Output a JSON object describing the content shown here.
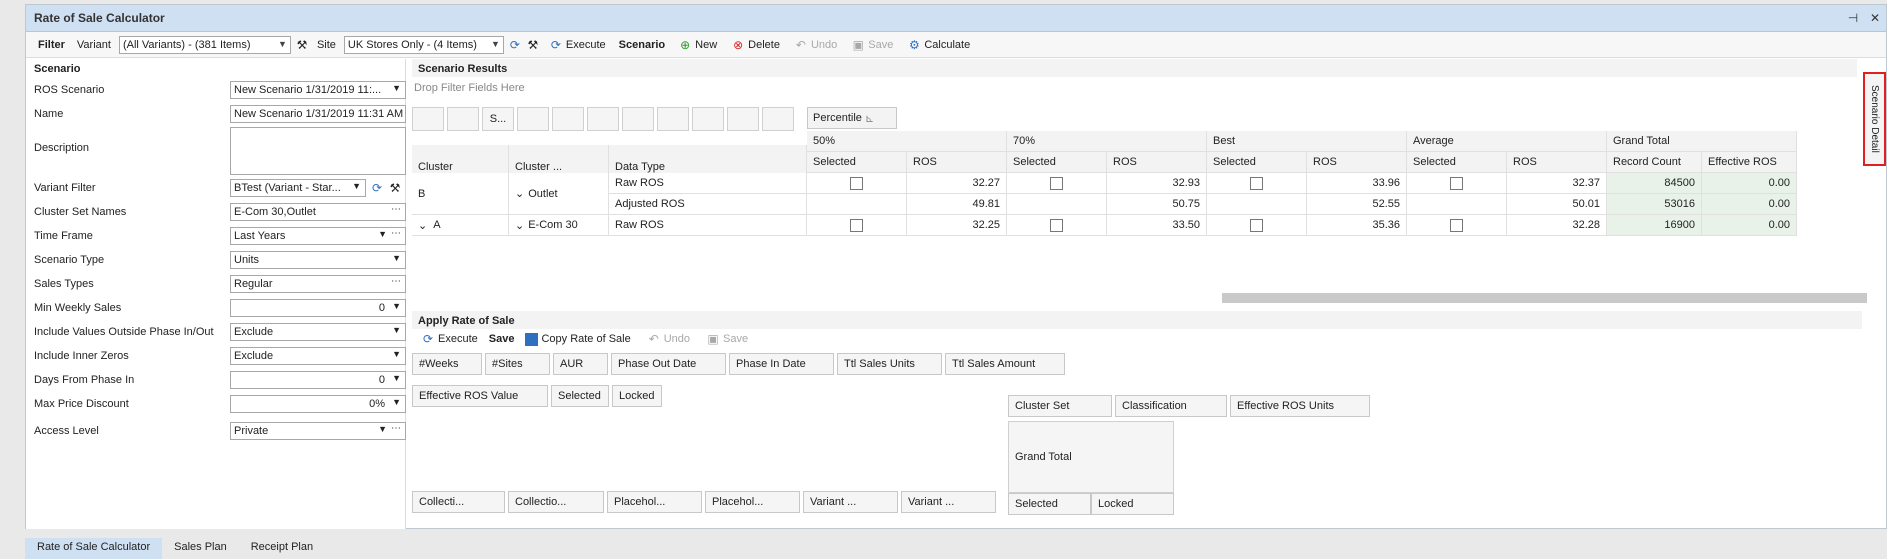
{
  "window": {
    "title": "Rate of Sale Calculator"
  },
  "toolbar": {
    "filter": "Filter",
    "variant_label": "Variant",
    "variant_value": "(All Variants) - (381 Items)",
    "site_label": "Site",
    "site_value": "UK Stores Only - (4 Items)",
    "execute": "Execute",
    "scenario": "Scenario",
    "new": "New",
    "delete": "Delete",
    "undo": "Undo",
    "save": "Save",
    "calculate": "Calculate"
  },
  "scenario_panel": {
    "title": "Scenario",
    "fields": [
      {
        "label": "ROS Scenario",
        "value": "New Scenario 1/31/2019 11:..."
      },
      {
        "label": "Name",
        "value": "New Scenario 1/31/2019 11:31 AM"
      },
      {
        "label": "Description",
        "value": ""
      },
      {
        "label": "Variant Filter",
        "value": "BTest (Variant - Star..."
      },
      {
        "label": "Cluster Set Names",
        "value": "E-Com 30,Outlet"
      },
      {
        "label": "Time Frame",
        "value": "Last Years"
      },
      {
        "label": "Scenario Type",
        "value": "Units"
      },
      {
        "label": "Sales Types",
        "value": "Regular"
      },
      {
        "label": "Min Weekly Sales",
        "value": "0"
      },
      {
        "label": "Include Values Outside Phase In/Out",
        "value": "Exclude"
      },
      {
        "label": "Include Inner Zeros",
        "value": "Exclude"
      },
      {
        "label": "Days From Phase In",
        "value": "0"
      },
      {
        "label": "Max Price Discount",
        "value": "0%"
      },
      {
        "label": "Access Level",
        "value": "Private"
      }
    ]
  },
  "results": {
    "title": "Scenario Results",
    "drop_hint": "Drop Filter Fields Here",
    "filter_box_label": "S...",
    "percentile": "Percentile",
    "row_headers": [
      "Cluster",
      "Cluster ...",
      "Data Type"
    ],
    "groups": [
      "50%",
      "70%",
      "Best",
      "Average",
      "Grand Total"
    ],
    "subcols": [
      "Selected",
      "ROS",
      "Selected",
      "ROS",
      "Selected",
      "ROS",
      "Selected",
      "ROS",
      "Record Count",
      "Effective ROS"
    ],
    "rows": [
      {
        "cluster": "B",
        "cluster2": "Outlet",
        "type": "Raw ROS",
        "v": [
          "32.27",
          "32.93",
          "33.96",
          "32.37"
        ],
        "count": "84500",
        "eff": "0.00"
      },
      {
        "cluster": "",
        "cluster2": "",
        "type": "Adjusted ROS",
        "v": [
          "49.81",
          "50.75",
          "52.55",
          "50.01"
        ],
        "count": "53016",
        "eff": "0.00"
      },
      {
        "cluster": "A",
        "cluster2": "E-Com 30",
        "type": "Raw ROS",
        "v": [
          "32.25",
          "33.50",
          "35.36",
          "32.28"
        ],
        "count": "16900",
        "eff": "0.00"
      }
    ]
  },
  "apply": {
    "title": "Apply Rate of Sale",
    "execute": "Execute",
    "save_bold": "Save",
    "copy": "Copy Rate of Sale",
    "undo": "Undo",
    "save": "Save",
    "chips": [
      "#Weeks",
      "#Sites",
      "AUR",
      "Phase Out Date",
      "Phase In Date",
      "Ttl Sales Units",
      "Ttl Sales Amount"
    ],
    "data_chips": [
      "Effective ROS Value",
      "Selected",
      "Locked"
    ],
    "col_chips": [
      "Cluster Set",
      "Classification",
      "Effective ROS Units"
    ],
    "row_chips": [
      "Collecti...",
      "Collectio...",
      "Placehol...",
      "Placehol...",
      "Variant ...",
      "Variant ..."
    ],
    "grand_total": "Grand Total",
    "gt_sub": [
      "Selected",
      "Locked"
    ]
  },
  "side_tab": "Scenario Detail",
  "bottom_tabs": [
    "Rate of Sale Calculator",
    "Sales Plan",
    "Receipt Plan"
  ]
}
